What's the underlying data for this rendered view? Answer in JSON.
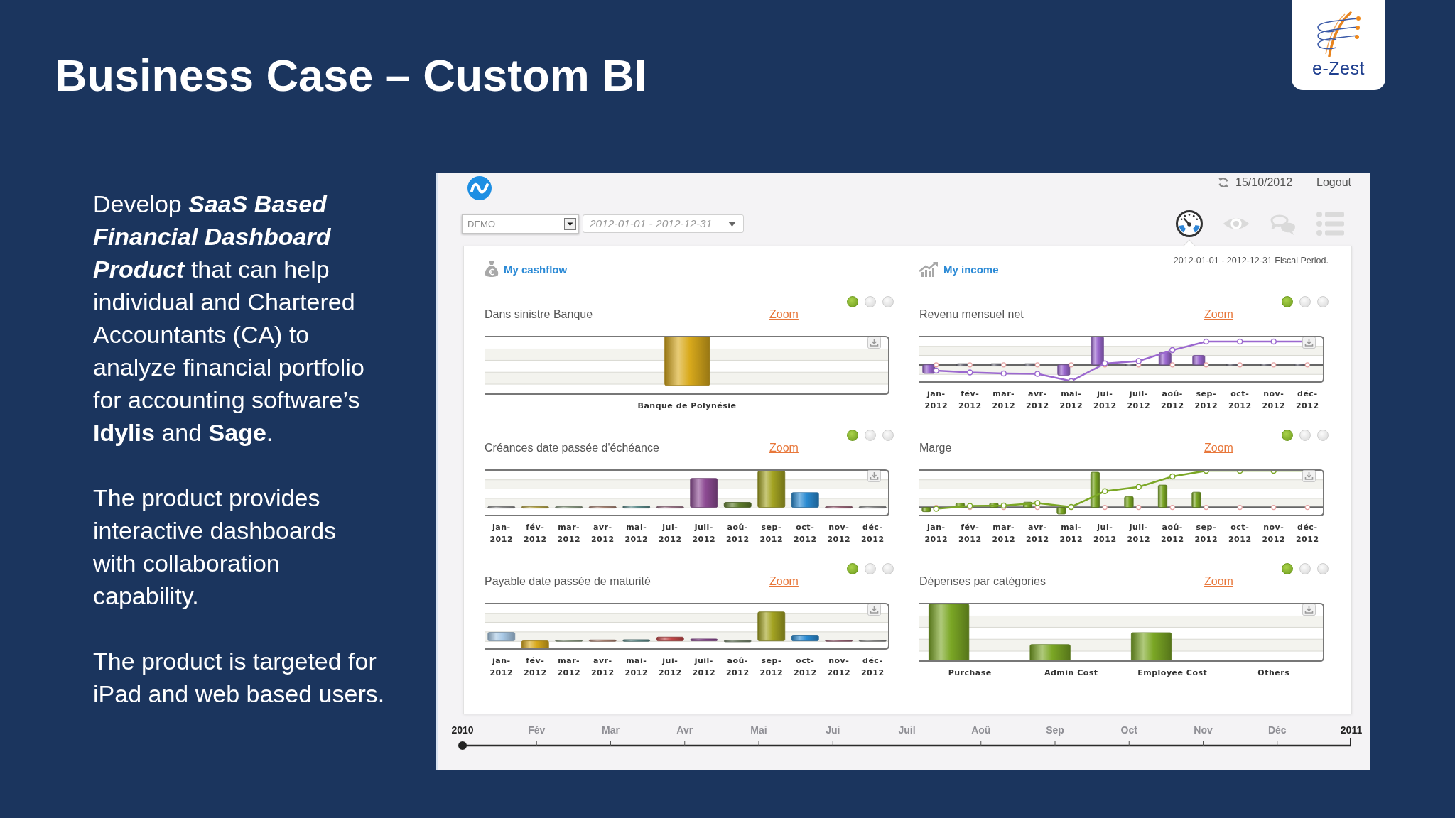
{
  "slide_title": "Business Case – Custom BI",
  "logo": {
    "text": "e-Zest"
  },
  "intro": [
    "Develop *SaaS Based*\n*Financial Dashboard*\n*Product* that can help\nindividual and Chartered\nAccountants (CA) to\nanalyze financial portfolio\nfor accounting software’s\n**Idylis** and **Sage**.",
    "The product provides\ninteractive dashboards\nwith collaboration\ncapability.",
    "The product is targeted for\niPad and web based users."
  ],
  "dashboard": {
    "date": "15/10/2012",
    "logout": "Logout",
    "account_select": {
      "value": "DEMO"
    },
    "period_field": {
      "value": "2012-01-01 - 2012-12-31"
    },
    "view_tabs": [
      {
        "selected": true
      },
      {
        "selected": false
      },
      {
        "selected": false
      },
      {
        "selected": false
      }
    ],
    "sections": [
      {
        "title": "My cashflow",
        "charts": [
          {
            "title": "Dans sinistre Banque",
            "zoom": "Zoom",
            "kind": "bar",
            "pages": [
              {
                "selected": true
              },
              {
                "selected": false
              },
              {
                "selected": false
              }
            ],
            "labels": [
              "Banque de Polynésie"
            ]
          },
          {
            "title": "Créances date passée d'échéance",
            "zoom": "Zoom",
            "kind": "bar",
            "pages": [
              {
                "selected": true
              },
              {
                "selected": false
              },
              {
                "selected": false
              }
            ],
            "labels": [
              "jan- 2012",
              "fév- 2012",
              "mar- 2012",
              "avr- 2012",
              "mai- 2012",
              "jui- 2012",
              "juil- 2012",
              "aoû- 2012",
              "sep- 2012",
              "oct- 2012",
              "nov- 2012",
              "déc- 2012"
            ]
          },
          {
            "title": "Payable date passée de maturité",
            "zoom": "Zoom",
            "kind": "bar",
            "pages": [
              {
                "selected": true
              },
              {
                "selected": false
              },
              {
                "selected": false
              }
            ],
            "labels": [
              "jan- 2012",
              "fév- 2012",
              "mar- 2012",
              "avr- 2012",
              "mai- 2012",
              "jui- 2012",
              "juil- 2012",
              "aoû- 2012",
              "sep- 2012",
              "oct- 2012",
              "nov- 2012",
              "déc- 2012"
            ]
          }
        ]
      },
      {
        "title": "My income",
        "note": "2012-01-01 - 2012-12-31 Fiscal Period.",
        "charts": [
          {
            "title": "Revenu mensuel net",
            "zoom": "Zoom",
            "kind": "bar_line",
            "pages": [
              {
                "selected": true
              },
              {
                "selected": false
              },
              {
                "selected": false
              }
            ],
            "labels": [
              "jan- 2012",
              "fév- 2012",
              "mar- 2012",
              "avr- 2012",
              "mai- 2012",
              "jui- 2012",
              "juil- 2012",
              "aoû- 2012",
              "sep- 2012",
              "oct- 2012",
              "nov- 2012",
              "déc- 2012"
            ]
          },
          {
            "title": "Marge",
            "zoom": "Zoom",
            "kind": "bar_line",
            "pages": [
              {
                "selected": true
              },
              {
                "selected": false
              },
              {
                "selected": false
              }
            ],
            "labels": [
              "jan- 2012",
              "fév- 2012",
              "mar- 2012",
              "avr- 2012",
              "mai- 2012",
              "jui- 2012",
              "juil- 2012",
              "aoû- 2012",
              "sep- 2012",
              "oct- 2012",
              "nov- 2012",
              "déc- 2012"
            ]
          },
          {
            "title": "Dépenses par catégories",
            "zoom": "Zoom",
            "kind": "bar",
            "pages": [
              {
                "selected": true
              },
              {
                "selected": false
              },
              {
                "selected": false
              }
            ],
            "labels": [
              "Purchase",
              "Admin Cost",
              "Employee Cost",
              "Others"
            ]
          }
        ]
      }
    ],
    "timeline": {
      "labels": [
        {
          "text": "2010",
          "kind": "year"
        },
        {
          "text": "Fév",
          "kind": "month"
        },
        {
          "text": "Mar",
          "kind": "month"
        },
        {
          "text": "Avr",
          "kind": "month"
        },
        {
          "text": "Mai",
          "kind": "month"
        },
        {
          "text": "Jui",
          "kind": "month"
        },
        {
          "text": "Juil",
          "kind": "month"
        },
        {
          "text": "Aoû",
          "kind": "month"
        },
        {
          "text": "Sep",
          "kind": "month"
        },
        {
          "text": "Oct",
          "kind": "month"
        },
        {
          "text": "Nov",
          "kind": "month"
        },
        {
          "text": "Déc",
          "kind": "month"
        },
        {
          "text": "2011",
          "kind": "year"
        }
      ],
      "level": 0
    }
  }
}
